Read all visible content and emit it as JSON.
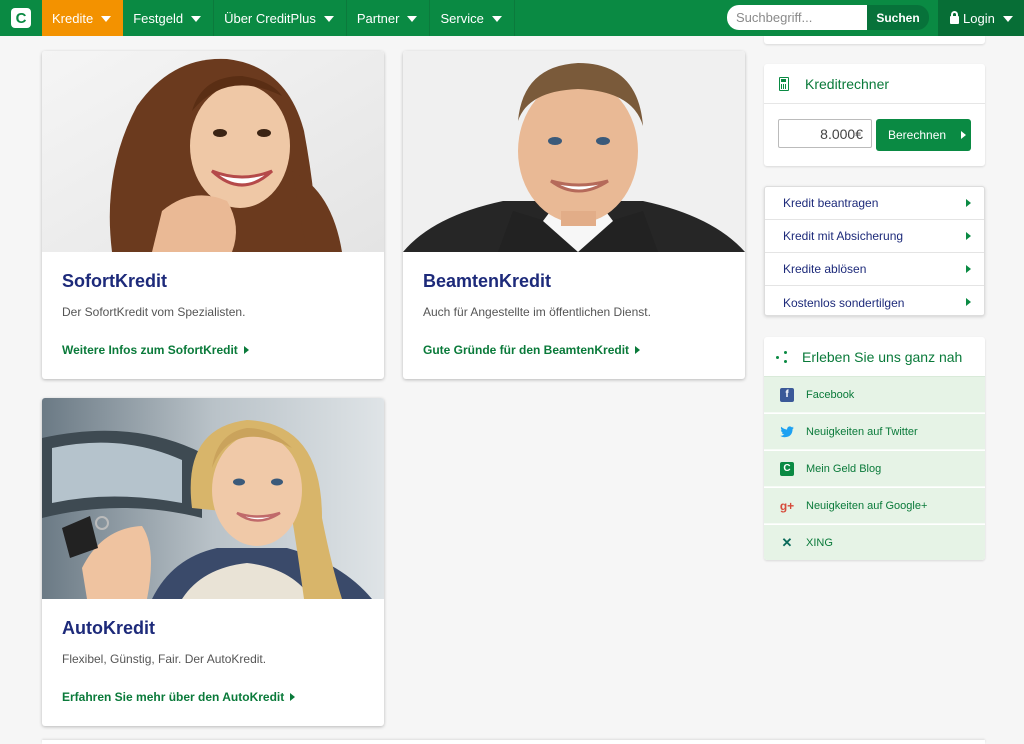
{
  "brand": {
    "logo_letter": "C"
  },
  "nav": {
    "items": [
      {
        "label": "Kredite",
        "active": true
      },
      {
        "label": "Festgeld",
        "active": false
      },
      {
        "label": "Über CreditPlus",
        "active": false
      },
      {
        "label": "Partner",
        "active": false
      },
      {
        "label": "Service",
        "active": false
      }
    ],
    "search": {
      "placeholder": "Suchbegriff...",
      "button": "Suchen"
    },
    "login": "Login"
  },
  "cards": [
    {
      "title": "SofortKredit",
      "desc": "Der SofortKredit vom Spezialisten.",
      "link": "Weitere Infos zum SofortKredit"
    },
    {
      "title": "BeamtenKredit",
      "desc": "Auch für Angestellte im öffentlichen Dienst.",
      "link": "Gute Gründe für den BeamtenKredit"
    },
    {
      "title": "AutoKredit",
      "desc": "Flexibel, Günstig, Fair. Der AutoKredit.",
      "link": "Erfahren Sie mehr über den AutoKredit"
    }
  ],
  "calculator": {
    "title": "Kreditrechner",
    "amount": "8.000€",
    "button": "Berechnen"
  },
  "quick_links": [
    "Kredit beantragen",
    "Kredit mit Absicherung",
    "Kredite ablösen",
    "Kostenlos sondertilgen"
  ],
  "social": {
    "title": "Erleben Sie uns ganz nah",
    "items": [
      {
        "label": "Facebook",
        "icon": "facebook-icon"
      },
      {
        "label": "Neuigkeiten auf Twitter",
        "icon": "twitter-icon"
      },
      {
        "label": "Mein Geld Blog",
        "icon": "blog-icon"
      },
      {
        "label": "Neuigkeiten auf Google+",
        "icon": "google-plus-icon"
      },
      {
        "label": "XING",
        "icon": "xing-icon"
      }
    ]
  },
  "colors": {
    "primary_green": "#0a8a43",
    "active_orange": "#f39200",
    "title_blue": "#1d2a7a"
  }
}
